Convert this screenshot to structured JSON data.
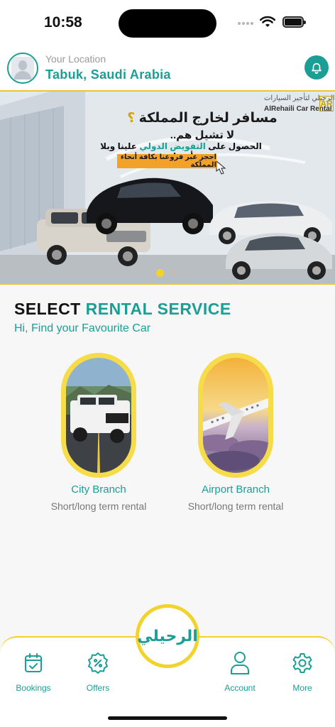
{
  "status_bar": {
    "time": "10:58"
  },
  "header": {
    "location_label": "Your Location",
    "location_value": "Tabuk, Saudi Arabia"
  },
  "banner": {
    "brand_ar": "الرحيلي لتأجير السيارات",
    "brand_en": "AlRehaili Car Rental",
    "title_ar": "مسافر لخارج المملكة",
    "title_q": "؟",
    "subtitle_ar": "لا تشيل هم..",
    "line_ar_1": "الحصول على",
    "line_ar_hl": "التفويض الدولي",
    "line_ar_2": "علينا وبلا أسهل",
    "cta_ar": "احجز عبر فروعنا بكافة أنحاء المملكة",
    "slides_total": 2,
    "slide_active": 1
  },
  "section": {
    "title_part1": "SELECT",
    "title_part2": "RENTAL SERVICE",
    "subtitle": "Hi, Find your Favourite Car"
  },
  "services": [
    {
      "label": "City Branch",
      "sub": "Short/long term rental"
    },
    {
      "label": "Airport Branch",
      "sub": "Short/long term rental"
    }
  ],
  "bottom_nav": {
    "center_logo": "الرحيلي",
    "items": [
      {
        "label": "Bookings",
        "icon": "calendar-check-icon"
      },
      {
        "label": "Offers",
        "icon": "percent-badge-icon"
      },
      {
        "label": "Account",
        "icon": "user-icon"
      },
      {
        "label": "More",
        "icon": "gear-icon"
      }
    ]
  },
  "colors": {
    "accent": "#1a9e95",
    "highlight": "#f2d32c"
  }
}
